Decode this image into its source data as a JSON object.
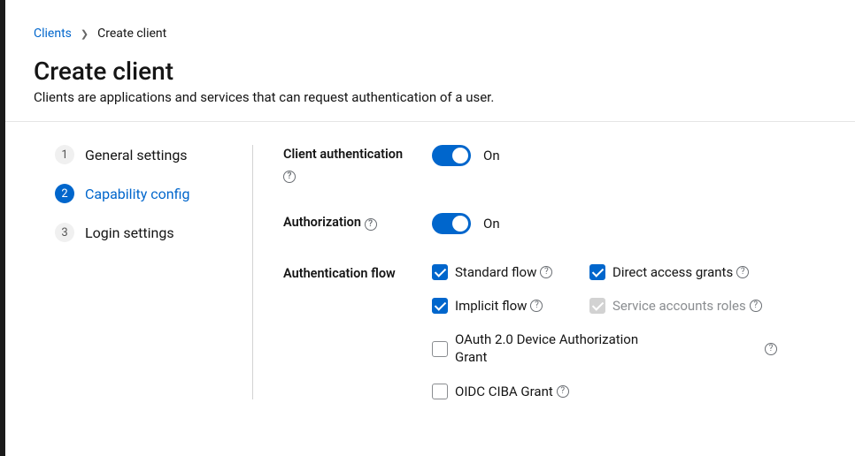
{
  "breadcrumb": {
    "parent": "Clients",
    "current": "Create client"
  },
  "title": "Create client",
  "subtitle": "Clients are applications and services that can request authentication of a user.",
  "steps": [
    {
      "num": "1",
      "label": "General settings"
    },
    {
      "num": "2",
      "label": "Capability config"
    },
    {
      "num": "3",
      "label": "Login settings"
    }
  ],
  "labels": {
    "client_auth": "Client authentication",
    "authorization": "Authorization",
    "auth_flow": "Authentication flow"
  },
  "toggle_on": "On",
  "flows": {
    "standard": "Standard flow",
    "direct": "Direct access grants",
    "implicit": "Implicit flow",
    "service": "Service accounts roles",
    "device": "OAuth 2.0 Device Authorization Grant",
    "ciba": "OIDC CIBA Grant"
  }
}
